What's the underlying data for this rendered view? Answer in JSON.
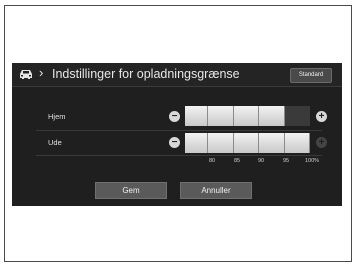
{
  "header": {
    "title": "Indstillinger for opladningsgrænse",
    "standard_label": "Standard"
  },
  "rows": [
    {
      "label": "Hjem",
      "level_percent": 95,
      "plus_enabled": true
    },
    {
      "label": "Ude",
      "level_percent": 100,
      "plus_enabled": false
    }
  ],
  "scale": [
    "80",
    "85",
    "90",
    "95",
    "100%"
  ],
  "buttons": {
    "save_label": "Gem",
    "cancel_label": "Annuller"
  },
  "colors": {
    "screen_bg": "#1f1f1f",
    "bar_fill": "#e8e8e8",
    "button_bg": "#5a5a5a"
  }
}
